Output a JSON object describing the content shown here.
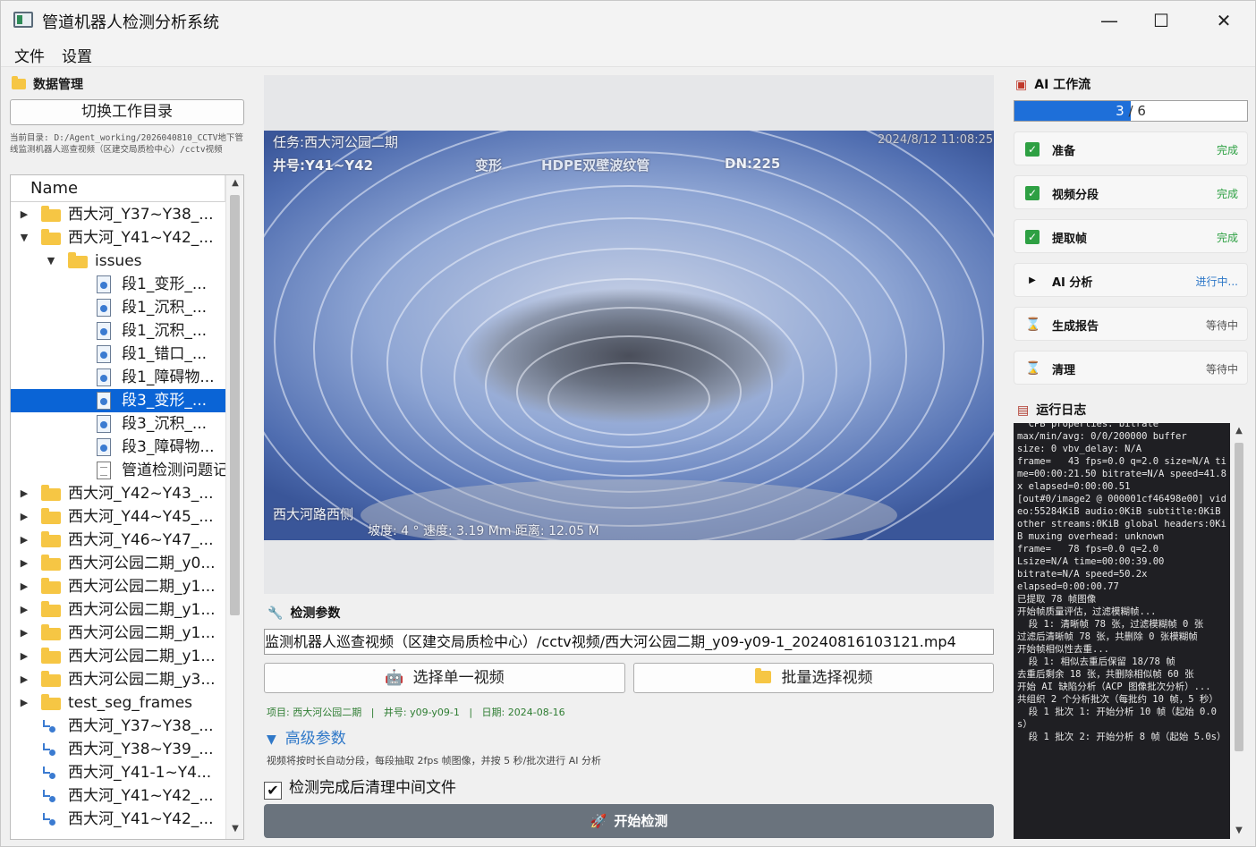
{
  "window": {
    "title": "管道机器人检测分析系统",
    "minimize": "—",
    "maximize": "☐",
    "close": "✕"
  },
  "menu": {
    "file": "文件",
    "settings": "设置"
  },
  "data_panel": {
    "title": "数据管理",
    "switch_button": "切换工作目录",
    "current_dir": "当前目录: D:/Agent_working/2026040810_CCTV地下管线监测机器人巡查视频（区建交局质检中心）/cctv视频",
    "tree_header": "Name",
    "tree": [
      {
        "label": "西大河_Y37~Y38_...",
        "icon": "folder",
        "arrow": "▶"
      },
      {
        "label": "西大河_Y41~Y42_...",
        "icon": "folder",
        "arrow": "▼"
      },
      {
        "label": "issues",
        "icon": "folder",
        "arrow": "▼"
      },
      {
        "label": "段1_变形_...",
        "icon": "image"
      },
      {
        "label": "段1_沉积_...",
        "icon": "image"
      },
      {
        "label": "段1_沉积_...",
        "icon": "image"
      },
      {
        "label": "段1_错口_...",
        "icon": "image"
      },
      {
        "label": "段1_障碍物...",
        "icon": "image"
      },
      {
        "label": "段3_变形_...",
        "icon": "image",
        "selected": true
      },
      {
        "label": "段3_沉积_...",
        "icon": "image"
      },
      {
        "label": "段3_障碍物...",
        "icon": "image"
      },
      {
        "label": "管道检测问题记...",
        "icon": "document"
      },
      {
        "label": "西大河_Y42~Y43_...",
        "icon": "folder",
        "arrow": "▶"
      },
      {
        "label": "西大河_Y44~Y45_...",
        "icon": "folder",
        "arrow": "▶"
      },
      {
        "label": "西大河_Y46~Y47_...",
        "icon": "folder",
        "arrow": "▶"
      },
      {
        "label": "西大河公园二期_y0...",
        "icon": "folder",
        "arrow": "▶"
      },
      {
        "label": "西大河公园二期_y1...",
        "icon": "folder",
        "arrow": "▶"
      },
      {
        "label": "西大河公园二期_y1...",
        "icon": "folder",
        "arrow": "▶"
      },
      {
        "label": "西大河公园二期_y1...",
        "icon": "folder",
        "arrow": "▶"
      },
      {
        "label": "西大河公园二期_y1...",
        "icon": "folder",
        "arrow": "▶"
      },
      {
        "label": "西大河公园二期_y3...",
        "icon": "folder",
        "arrow": "▶"
      },
      {
        "label": "test_seg_frames",
        "icon": "folder",
        "arrow": "▶"
      },
      {
        "label": "西大河_Y37~Y38_...",
        "icon": "video"
      },
      {
        "label": "西大河_Y38~Y39_...",
        "icon": "video"
      },
      {
        "label": "西大河_Y41-1~Y4...",
        "icon": "video"
      },
      {
        "label": "西大河_Y41~Y42_...",
        "icon": "video"
      },
      {
        "label": "西大河_Y41~Y42_...",
        "icon": "video"
      }
    ]
  },
  "video_overlay": {
    "task": "任务:西大河公园二期",
    "timestamp": "2024/8/12 11:08:25",
    "well": "井号:Y41~Y42",
    "mark": "变形",
    "material": "HDPE双壁波纹管",
    "dn": "DN:225",
    "location": "西大河路西侧",
    "telemetry": "坡度:  4 °   速度:  3.19 Mm 距离:  12.05 M"
  },
  "params": {
    "title": "检测参数",
    "path": "监测机器人巡查视频（区建交局质检中心）/cctv视频/西大河公园二期_y09-y09-1_20240816103121.mp4",
    "single_button": "选择单一视频",
    "batch_button": "批量选择视频",
    "meta": "项目: 西大河公园二期   |   井号: y09-y09-1   |   日期: 2024-08-16",
    "advanced": "高级参数",
    "hint": "视频将按时长自动分段，每段抽取 2fps 帧图像，并按 5 秒/批次进行 AI 分析",
    "cleanup_label": "检测完成后清理中间文件",
    "cleanup_checked": "✔",
    "start_button": "开始检测"
  },
  "workflow": {
    "title": "AI 工作流",
    "progress_current": "3",
    "progress_sep": "/",
    "progress_total": "6",
    "progress_fraction": 0.5,
    "steps": [
      {
        "name": "准备",
        "status": "完成",
        "state": "done"
      },
      {
        "name": "视频分段",
        "status": "完成",
        "state": "done"
      },
      {
        "name": "提取帧",
        "status": "完成",
        "state": "done"
      },
      {
        "name": "AI 分析",
        "status": "进行中...",
        "state": "running"
      },
      {
        "name": "生成报告",
        "status": "等待中",
        "state": "waiting"
      },
      {
        "name": "清理",
        "status": "等待中",
        "state": "waiting"
      }
    ]
  },
  "log": {
    "title": "运行日志",
    "text": "  CPB properties: bitrate\nmax/min/avg: 0/0/200000 buffer\nsize: 0 vbv_delay: N/A\nframe=   43 fps=0.0 q=2.0 size=N/A time=00:00:21.50 bitrate=N/A speed=41.8x elapsed=0:00:00.51\n[out#0/image2 @ 000001cf46498e00] video:55284KiB audio:0KiB subtitle:0KiB other streams:0KiB global headers:0KiB muxing overhead: unknown\nframe=   78 fps=0.0 q=2.0\nLsize=N/A time=00:00:39.00\nbitrate=N/A speed=50.2x\nelapsed=0:00:00.77\n已提取 78 帧图像\n开始帧质量评估，过滤模糊帧...\n  段 1: 清晰帧 78 张，过滤模糊帧 0 张\n过滤后清晰帧 78 张，共删除 0 张模糊帧\n开始帧相似性去重...\n  段 1: 相似去重后保留 18/78 帧\n去重后剩余 18 张，共删除相似帧 60 张\n开始 AI 缺陷分析（ACP 图像批次分析）...\n共组织 2 个分析批次（每批约 10 帧，5 秒）\n  段 1 批次 1: 开始分析 10 帧（起始 0.0s）\n  段 1 批次 2: 开始分析 8 帧（起始 5.0s）"
  },
  "colors": {
    "accent": "#1e6fd9",
    "done": "#2ea043",
    "running": "#2f78c8",
    "start_button": "#6a737d",
    "log_bg": "#1f1f23"
  }
}
